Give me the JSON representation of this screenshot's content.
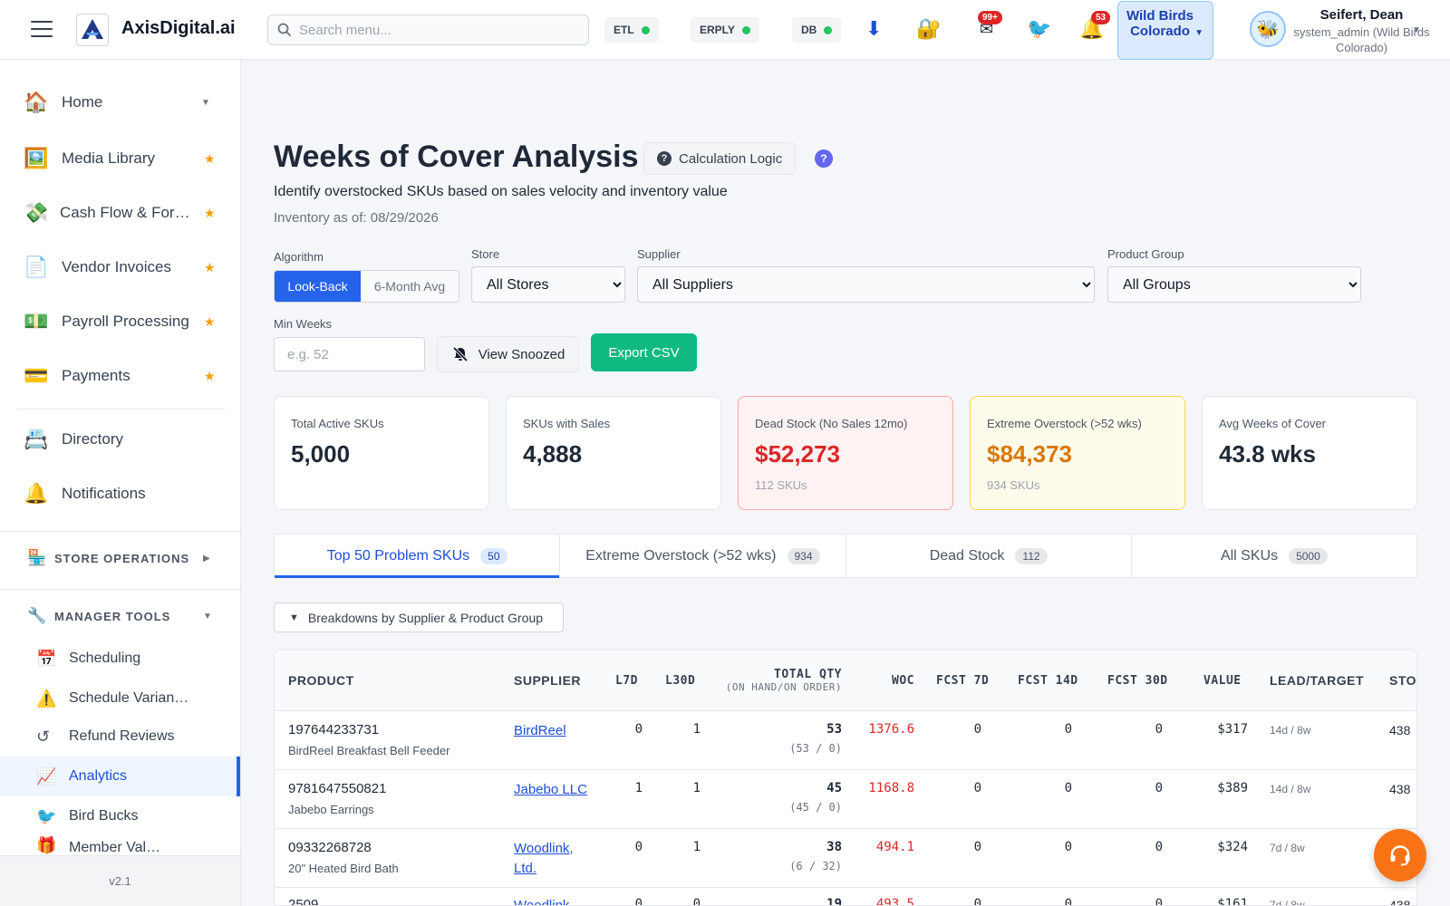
{
  "header": {
    "brand": "AxisDigital.ai",
    "search_placeholder": "Search menu...",
    "status": [
      {
        "label": "ETL"
      },
      {
        "label": "ERPLY"
      },
      {
        "label": "DB"
      }
    ],
    "mail_badge": "99+",
    "bell_badge": "53",
    "store_label": "Wild Birds Colorado",
    "user_name": "Seifert, Dean",
    "user_role": "system_admin (Wild Birds Colorado)",
    "colors": {
      "status_ok": "#22c55e",
      "badge": "#dc2626"
    }
  },
  "sidebar": {
    "items": [
      {
        "label": "Home",
        "icon": "house-icon",
        "glyph": "🏠"
      },
      {
        "label": "Media Library",
        "icon": "picture-icon",
        "glyph": "🖼️"
      },
      {
        "label": "Cash Flow & For…",
        "icon": "money-icon",
        "glyph": "💸"
      },
      {
        "label": "Vendor Invoices",
        "icon": "document-icon",
        "glyph": "📄"
      },
      {
        "label": "Payroll Processing",
        "icon": "cash-icon",
        "glyph": "💵"
      },
      {
        "label": "Payments",
        "icon": "credit-card-icon",
        "glyph": "💳"
      },
      {
        "label": "Directory",
        "icon": "rolodex-icon",
        "glyph": "📇"
      },
      {
        "label": "Notifications",
        "icon": "bell-icon",
        "glyph": "🔔"
      }
    ],
    "store_operations": "STORE OPERATIONS",
    "manager_tools": "MANAGER TOOLS",
    "sub_items": [
      {
        "label": "Scheduling",
        "icon": "calendar-icon",
        "glyph": "📅"
      },
      {
        "label": "Schedule Varian…",
        "icon": "warning-icon",
        "glyph": "⚠️"
      },
      {
        "label": "Refund Reviews",
        "icon": "undo-icon",
        "glyph": "↺"
      },
      {
        "label": "Analytics",
        "icon": "chart-icon",
        "glyph": "📈"
      },
      {
        "label": "Bird Bucks",
        "icon": "bird-icon",
        "glyph": "🐦"
      },
      {
        "label": "Member Val…",
        "icon": "gift-icon",
        "glyph": "🎁"
      }
    ],
    "version": "v2.1"
  },
  "page": {
    "title": "Weeks of Cover Analysis",
    "calc_button": "Calculation Logic",
    "help": "?",
    "subtitle": "Identify overstocked SKUs based on sales velocity and inventory value",
    "as_of": "Inventory as of: 08/29/2026"
  },
  "filters": {
    "algorithm_label": "Algorithm",
    "algo_on": "Look-Back",
    "algo_off": "6-Month Avg",
    "store_label": "Store",
    "store_value": "All Stores",
    "supplier_label": "Supplier",
    "supplier_value": "All Suppliers",
    "group_label": "Product Group",
    "group_value": "All Groups",
    "min_weeks_label": "Min Weeks",
    "min_weeks_placeholder": "e.g. 52",
    "snoozed_button": "View Snoozed",
    "export_button": "Export CSV"
  },
  "cards": [
    {
      "title": "Total Active SKUs",
      "value": "5,000",
      "sub": ""
    },
    {
      "title": "SKUs with Sales",
      "value": "4,888",
      "sub": ""
    },
    {
      "title": "Dead Stock (No Sales 12mo)",
      "value": "$52,273",
      "sub": "112 SKUs"
    },
    {
      "title": "Extreme Overstock (>52 wks)",
      "value": "$84,373",
      "sub": "934 SKUs"
    },
    {
      "title": "Avg Weeks of Cover",
      "value": "43.8 wks",
      "sub": ""
    }
  ],
  "tabs": [
    {
      "label": "Top 50 Problem SKUs",
      "count": "50"
    },
    {
      "label": "Extreme Overstock (>52 wks)",
      "count": "934"
    },
    {
      "label": "Dead Stock",
      "count": "112"
    },
    {
      "label": "All SKUs",
      "count": "5000"
    }
  ],
  "breakdown_label": "Breakdowns by Supplier & Product Group",
  "table": {
    "headers": {
      "product": "PRODUCT",
      "supplier": "SUPPLIER",
      "l7d": "L7D",
      "l30d": "L30D",
      "total_qty": "TOTAL QTY",
      "total_qty_sub": "(ON HAND/ON ORDER)",
      "woc": "WOC",
      "fcst7": "FCST 7D",
      "fcst14": "FCST 14D",
      "fcst30": "FCST 30D",
      "value": "VALUE",
      "lead": "LEAD/TARGET",
      "store": "STO"
    },
    "rows": [
      {
        "code": "197644233731",
        "name": "BirdReel Breakfast Bell Feeder",
        "supplier": "BirdReel",
        "l7d": "0",
        "l30d": "1",
        "qty": "53",
        "qty_sub": "(53 / 0)",
        "woc": "1376.6",
        "f7": "0",
        "f14": "0",
        "f30": "0",
        "value": "$317",
        "lead": "14d / 8w",
        "store": "438"
      },
      {
        "code": "9781647550821",
        "name": "Jabebo Earrings",
        "supplier": "Jabebo LLC",
        "l7d": "1",
        "l30d": "1",
        "qty": "45",
        "qty_sub": "(45 / 0)",
        "woc": "1168.8",
        "f7": "0",
        "f14": "0",
        "f30": "0",
        "value": "$389",
        "lead": "14d / 8w",
        "store": "438"
      },
      {
        "code": "09332268728",
        "name": "20\" Heated Bird Bath",
        "supplier": "Woodlink, Ltd.",
        "l7d": "0",
        "l30d": "1",
        "qty": "38",
        "qty_sub": "(6 / 32)",
        "woc": "494.1",
        "f7": "0",
        "f14": "0",
        "f30": "0",
        "value": "$324",
        "lead": "7d / 8w",
        "store": ""
      },
      {
        "code": "2509",
        "name": "",
        "supplier": "Woodlink",
        "l7d": "0",
        "l30d": "0",
        "qty": "19",
        "qty_sub": "",
        "woc": "493.5",
        "f7": "0",
        "f14": "0",
        "f30": "0",
        "value": "$161",
        "lead": "7d / 8w",
        "store": "438"
      }
    ]
  }
}
